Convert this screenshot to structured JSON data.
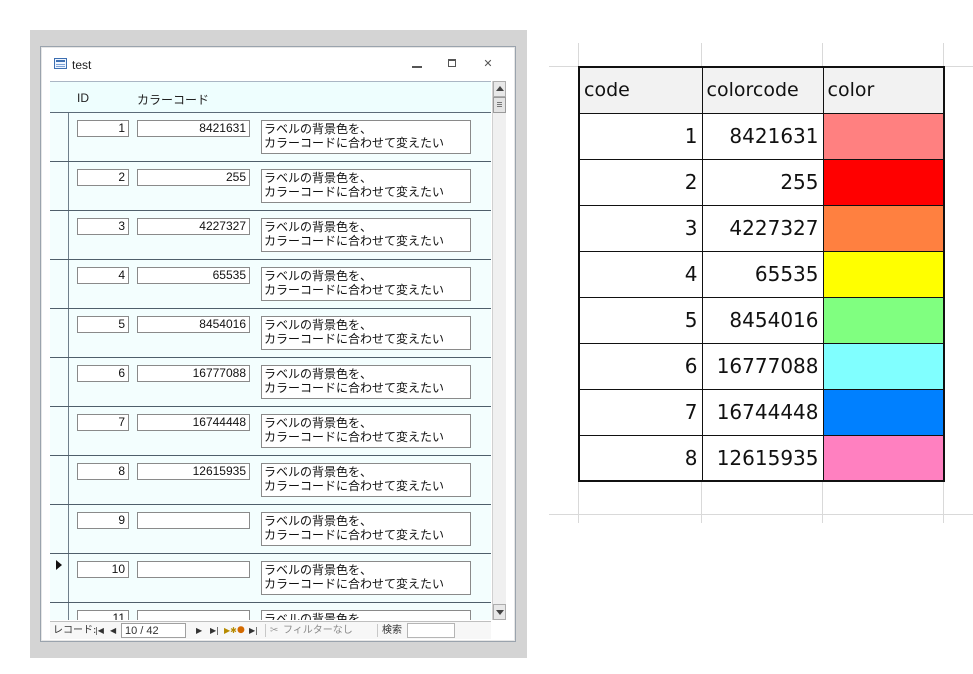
{
  "access_window": {
    "title": "test",
    "header": {
      "id_label": "ID",
      "colorcode_label": "カラーコード"
    },
    "label_text_line1": "ラベルの背景色を、",
    "label_text_line2": "カラーコードに合わせて変えたい",
    "records": [
      {
        "id": "1",
        "colorcode": "8421631"
      },
      {
        "id": "2",
        "colorcode": "255"
      },
      {
        "id": "3",
        "colorcode": "4227327"
      },
      {
        "id": "4",
        "colorcode": "65535"
      },
      {
        "id": "5",
        "colorcode": "8454016"
      },
      {
        "id": "6",
        "colorcode": "16777088"
      },
      {
        "id": "7",
        "colorcode": "16744448"
      },
      {
        "id": "8",
        "colorcode": "12615935"
      },
      {
        "id": "9",
        "colorcode": ""
      },
      {
        "id": "10",
        "colorcode": ""
      },
      {
        "id": "11",
        "colorcode": ""
      }
    ],
    "current_record_index": 9,
    "navbar": {
      "record_label": "レコード:",
      "position": "10 / 42",
      "filter_label": "フィルターなし",
      "search_label": "検索"
    }
  },
  "spreadsheet": {
    "headers": [
      "code",
      "colorcode",
      "color"
    ],
    "rows": [
      {
        "code": "1",
        "colorcode": "8421631",
        "color": "#ff8080"
      },
      {
        "code": "2",
        "colorcode": "255",
        "color": "#ff0000"
      },
      {
        "code": "3",
        "colorcode": "4227327",
        "color": "#ff8040"
      },
      {
        "code": "4",
        "colorcode": "65535",
        "color": "#ffff00"
      },
      {
        "code": "5",
        "colorcode": "8454016",
        "color": "#80ff80"
      },
      {
        "code": "6",
        "colorcode": "16777088",
        "color": "#80ffff"
      },
      {
        "code": "7",
        "colorcode": "16744448",
        "color": "#0080ff"
      },
      {
        "code": "8",
        "colorcode": "12615935",
        "color": "#ff80c0"
      }
    ]
  }
}
